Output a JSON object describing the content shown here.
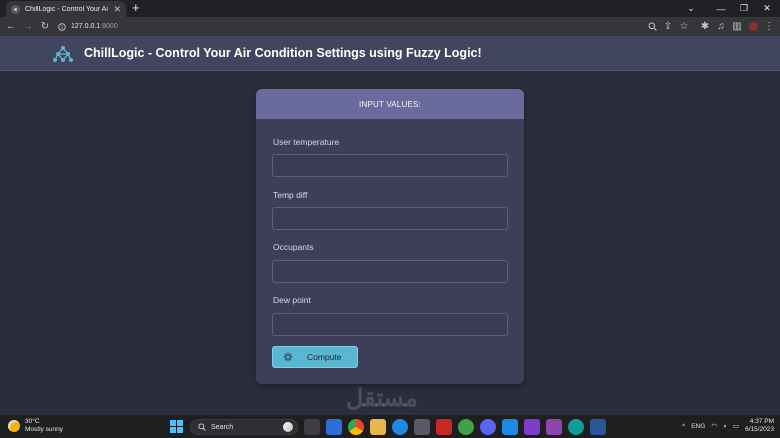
{
  "browser": {
    "tab_title": "ChillLogic - Control Your Air Con",
    "url_host": "127.0.0.1",
    "url_port": ":8000"
  },
  "header": {
    "title": "ChillLogic - Control Your Air Condition Settings using Fuzzy Logic!"
  },
  "form": {
    "heading": "INPUT VALUES:",
    "fields": [
      {
        "label": "User temperature",
        "value": ""
      },
      {
        "label": "Temp diff",
        "value": ""
      },
      {
        "label": "Occupants",
        "value": ""
      },
      {
        "label": "Dew point",
        "value": ""
      }
    ],
    "submit_label": "Compute"
  },
  "watermark": {
    "arabic": "مستقل",
    "latin": "mostaql.com"
  },
  "taskbar": {
    "weather_temp": "30°C",
    "weather_desc": "Mostly sunny",
    "search_label": "Search",
    "language": "ENG",
    "time": "4:37 PM",
    "date": "6/15/2023"
  },
  "colors": {
    "page_bg": "#2c2d3c",
    "header_bg": "#424560",
    "card_bg": "#3d3f58",
    "card_head_bg": "#6a6a9c",
    "accent_button": "#5ab7d2"
  }
}
